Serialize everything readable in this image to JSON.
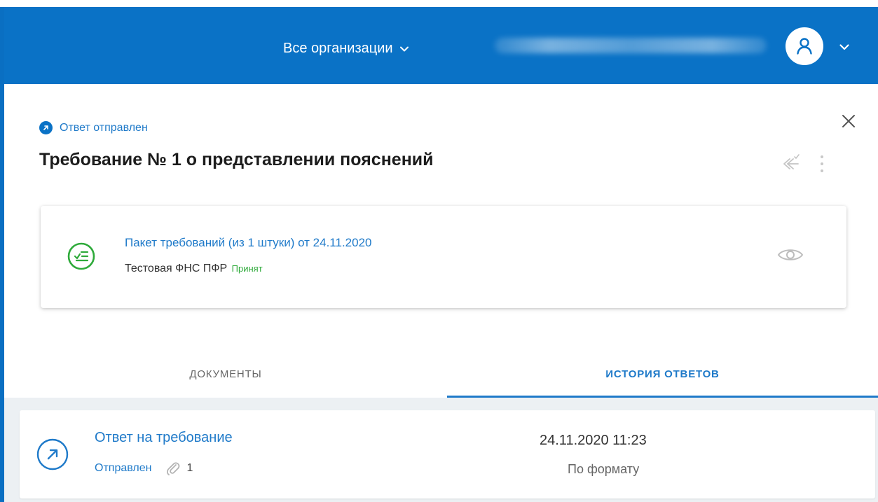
{
  "header": {
    "org_switch_label": "Все организации",
    "user_name": "",
    "colors": {
      "bar": "#0a72c6",
      "accent": "#1f7ac9",
      "success": "#2eaa3a"
    }
  },
  "document": {
    "status_text": "Ответ отправлен",
    "title": "Требование № 1 о представлении пояснений",
    "icons": [
      "reply-all-icon",
      "more-vertical-icon",
      "close-icon"
    ]
  },
  "package_card": {
    "link": "Пакет требований (из 1 штуки) от 24.11.2020",
    "sender": "Тестовая ФНС ПФР",
    "status": "Принят",
    "icons": [
      "checklist-icon",
      "eye-icon"
    ]
  },
  "tabs": [
    {
      "label": "ДОКУМЕНТЫ",
      "active": false
    },
    {
      "label": "ИСТОРИЯ ОТВЕТОВ",
      "active": true
    }
  ],
  "history": [
    {
      "title": "Ответ на требование",
      "status": "Отправлен",
      "attachments": "1",
      "datetime": "24.11.2020 11:23",
      "format": "По формату",
      "icons": [
        "outgoing-arrow-icon",
        "paperclip-icon"
      ]
    }
  ]
}
